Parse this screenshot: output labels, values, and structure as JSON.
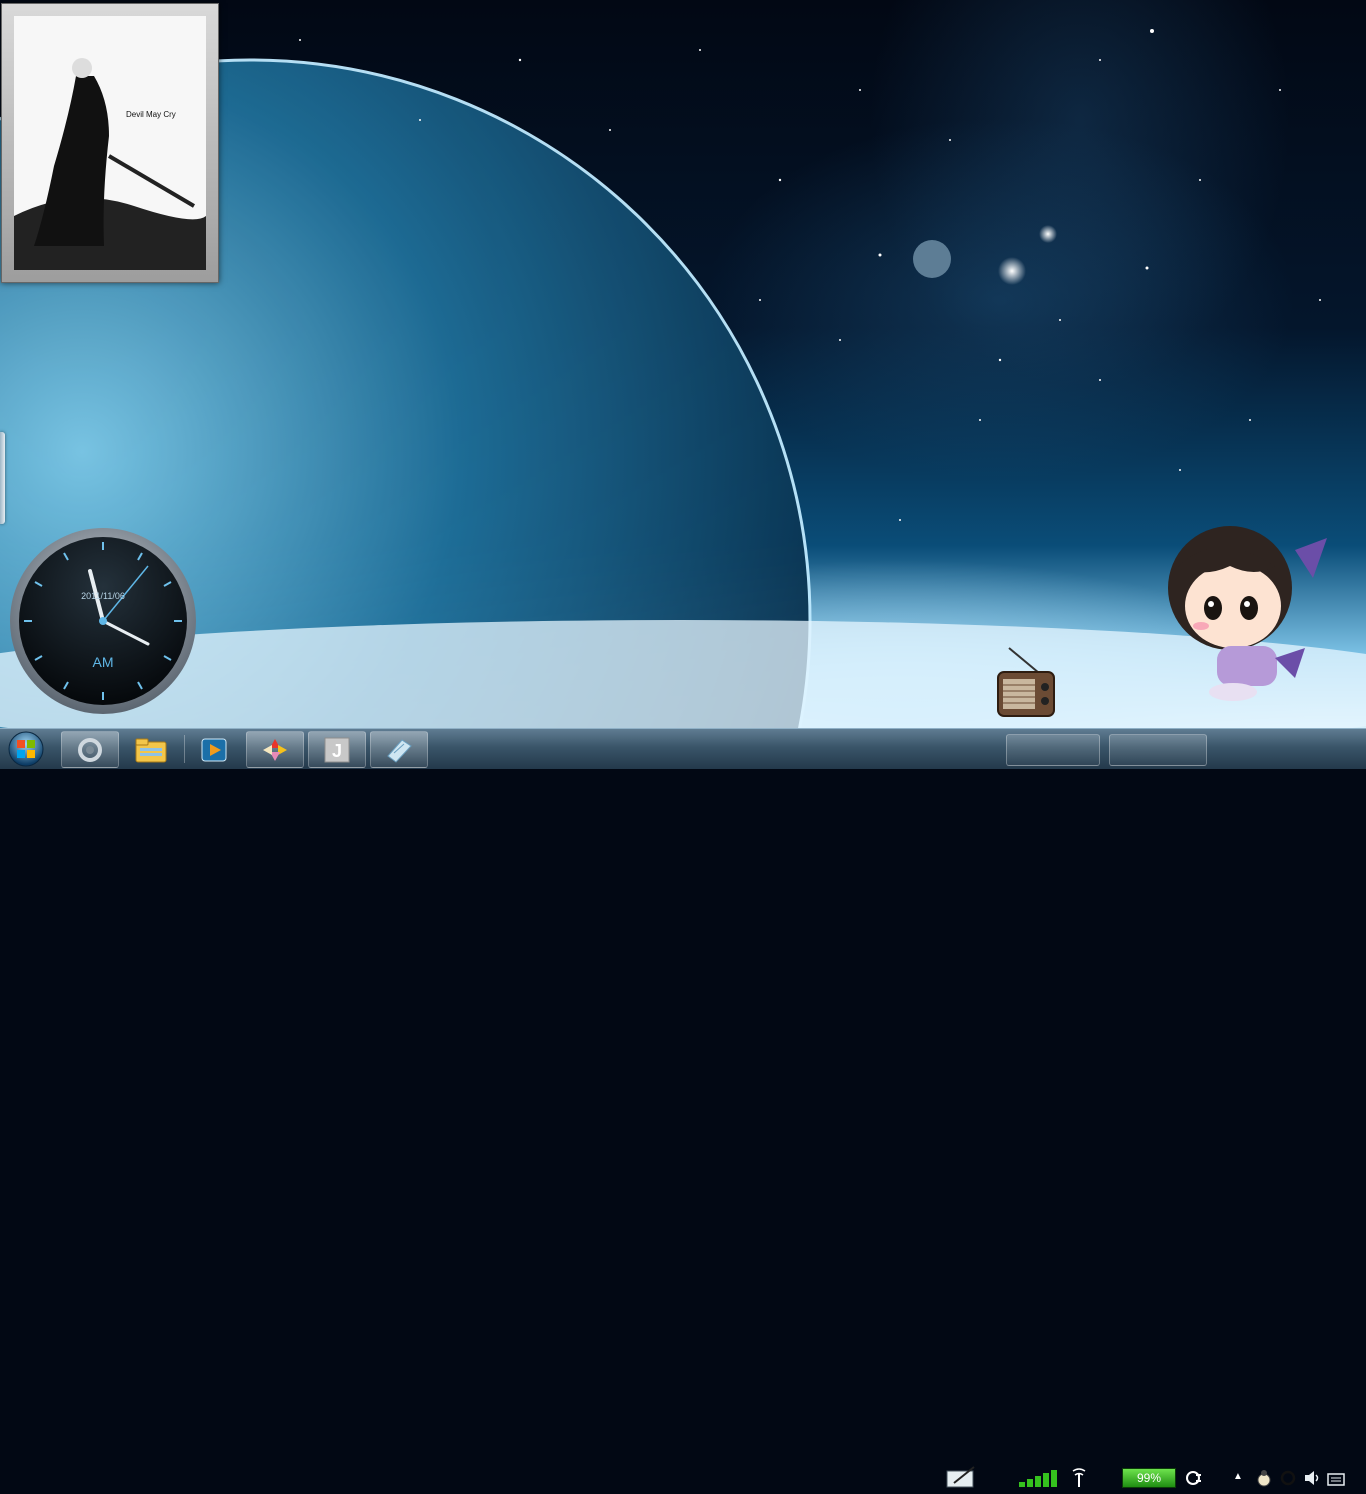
{
  "desktop": {
    "photo_gadget": {
      "caption": "Devil May Cry"
    },
    "clock_gadget": {
      "date": "2011/11/06",
      "ampm": "AM"
    }
  },
  "taskbar": {
    "start_button": "start-orb-icon",
    "pinned": [
      {
        "icon": "browser-ring-icon"
      },
      {
        "icon": "file-explorer-icon"
      },
      {
        "icon": "media-player-icon"
      },
      {
        "icon": "pinwheel-app-icon"
      },
      {
        "icon": "j-letter-app-icon"
      },
      {
        "icon": "notepad-app-icon"
      }
    ],
    "tray": {
      "pen_input_icon": "pen-input-icon",
      "signal_icon": "signal-strength-icon",
      "antenna_icon": "wireless-antenna-icon",
      "battery_percent": "99%",
      "power_plug_icon": "power-plug-icon",
      "show_hidden_icon": "chevron-up-icon",
      "volume_icon": "speaker-icon"
    }
  },
  "colors": {
    "taskbar_top": "#5f7c92",
    "taskbar_bottom": "#24394b",
    "battery_green": "#3fc22a",
    "clock_accent": "#5fb6e6"
  }
}
